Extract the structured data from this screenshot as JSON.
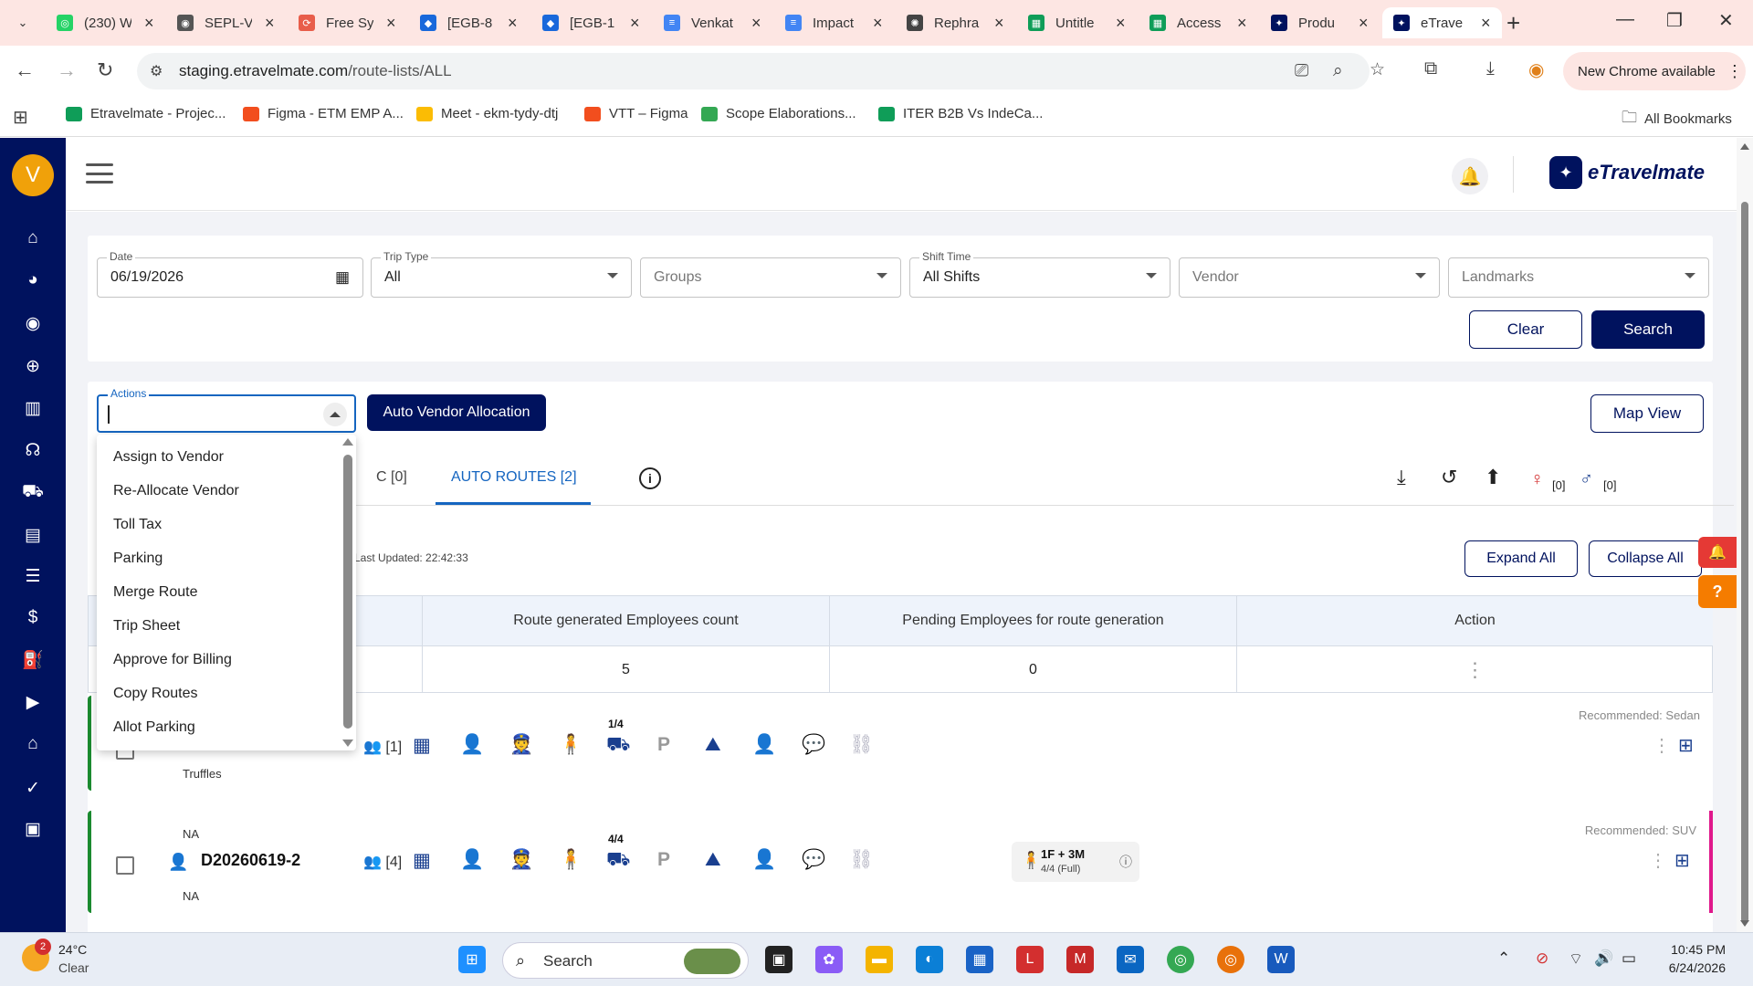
{
  "browser": {
    "tabs": [
      {
        "title": "(230) W",
        "fav_color": "#25d366",
        "fav_glyph": "◎"
      },
      {
        "title": "SEPL-V",
        "fav_color": "#555555",
        "fav_glyph": "◉"
      },
      {
        "title": "Free Sy",
        "fav_color": "#e85d4a",
        "fav_glyph": "⟳"
      },
      {
        "title": "[EGB-8",
        "fav_color": "#1868db",
        "fav_glyph": "◆"
      },
      {
        "title": "[EGB-1",
        "fav_color": "#1868db",
        "fav_glyph": "◆"
      },
      {
        "title": "Venkat",
        "fav_color": "#4285f4",
        "fav_glyph": "≡"
      },
      {
        "title": "Impact",
        "fav_color": "#4285f4",
        "fav_glyph": "≡"
      },
      {
        "title": "Rephra",
        "fav_color": "#444444",
        "fav_glyph": "✺"
      },
      {
        "title": "Untitle",
        "fav_color": "#0f9d58",
        "fav_glyph": "▦"
      },
      {
        "title": "Access",
        "fav_color": "#0f9d58",
        "fav_glyph": "▦"
      },
      {
        "title": "Produ",
        "fav_color": "#00125e",
        "fav_glyph": "✦"
      },
      {
        "title": "eTrave",
        "fav_color": "#00125e",
        "fav_glyph": "✦"
      }
    ],
    "url_domain": "staging.etravelmate.com",
    "url_path": "/route-lists/ALL",
    "new_chrome_label": "New Chrome available",
    "bookmarks": [
      {
        "label": "Etravelmate - Projec...",
        "color": "#0f9d58"
      },
      {
        "label": "Figma - ETM EMP A...",
        "color": "#f24e1e"
      },
      {
        "label": "Meet - ekm-tydy-dtj",
        "color": "#fbbc04"
      },
      {
        "label": "VTT – Figma",
        "color": "#f24e1e"
      },
      {
        "label": "Scope Elaborations...",
        "color": "#34a853"
      },
      {
        "label": "ITER B2B Vs IndeCa...",
        "color": "#0f9d58"
      }
    ],
    "all_bookmarks_label": "All Bookmarks"
  },
  "app": {
    "avatar_letter": "V",
    "logo_text": "eTravelmate",
    "sidebar_icons": [
      "home-icon",
      "palette-icon",
      "user-circle-icon",
      "globe-icon",
      "building-icon",
      "support-icon",
      "car-icon",
      "clipboard-icon",
      "receipt-icon",
      "money-icon",
      "fuel-icon",
      "video-icon",
      "house-icon",
      "check-circle-icon",
      "report-icon"
    ]
  },
  "filters": {
    "date": {
      "label": "Date",
      "value": "06/19/2026"
    },
    "trip_type": {
      "label": "Trip Type",
      "value": "All"
    },
    "groups": {
      "placeholder": "Groups"
    },
    "shift_time": {
      "label": "Shift Time",
      "value": "All Shifts"
    },
    "vendor": {
      "placeholder": "Vendor"
    },
    "landmarks": {
      "placeholder": "Landmarks"
    },
    "clear_label": "Clear",
    "search_label": "Search"
  },
  "actions_bar": {
    "actions_label": "Actions",
    "auto_vendor_label": "Auto Vendor Allocation",
    "map_view_label": "Map View"
  },
  "actions_menu": [
    "Assign to Vendor",
    "Re-Allocate Vendor",
    "Toll Tax",
    "Parking",
    "Merge Route",
    "Trip Sheet",
    "Approve for Billing",
    "Copy Routes",
    "Allot Parking"
  ],
  "route_tabs": {
    "partial_tab": "C [0]",
    "auto_routes": "AUTO ROUTES [2]",
    "female_count": "[0]",
    "male_count": "[0]"
  },
  "last_updated": "Last Updated: 22:42:33",
  "expand_all": "Expand All",
  "collapse_all": "Collapse All",
  "summary_table": {
    "headers": [
      "Route generated Employees count",
      "Pending Employees for route generation",
      "Action"
    ],
    "row": [
      "5",
      "0",
      "⋮"
    ]
  },
  "routes": [
    {
      "top_line": "",
      "bottom_line": "Truffles",
      "id": "",
      "group_count": "[1]",
      "capacity": "1/4",
      "recommended": "Recommended: Sedan"
    },
    {
      "top_line": "NA",
      "bottom_line": "NA",
      "id": "D20260619-2",
      "group_count": "[4]",
      "capacity": "4/4",
      "recommended": "Recommended: SUV",
      "vehicle_mix": "1F + 3M",
      "vehicle_fill": "4/4 (Full)"
    }
  ],
  "taskbar": {
    "temp": "24°C",
    "condition": "Clear",
    "weather_badge": "2",
    "search_label": "Search",
    "time": "10:45 PM",
    "date": "6/24/2026"
  }
}
